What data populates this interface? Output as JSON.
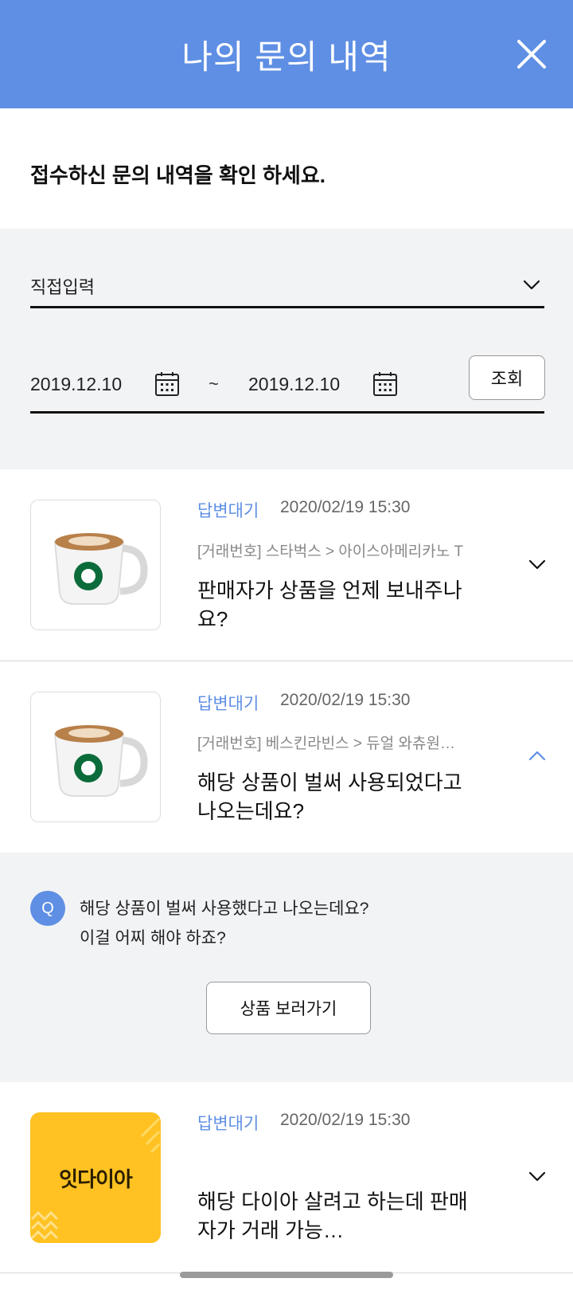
{
  "header": {
    "title": "나의 문의 내역"
  },
  "intro": "접수하신 문의 내역을 확인 하세요.",
  "filter": {
    "select_value": "직접입력",
    "start_date": "2019.12.10",
    "separator": "~",
    "end_date": "2019.12.10",
    "search_label": "조회"
  },
  "inquiries": [
    {
      "status": "답변대기",
      "date": "2020/02/19 15:30",
      "trade": "[거래번호] 스타벅스 > 아이스아메리카노 T",
      "question": "판매자가 상품을 언제 보내주나요?"
    },
    {
      "status": "답변대기",
      "date": "2020/02/19 15:30",
      "trade": "[거래번호] 베스킨라빈스 > 듀얼 와츄원…",
      "question": "해당 상품이 벌써 사용되었다고 나오는데요?",
      "expanded": true
    },
    {
      "status": "답변대기",
      "date": "2020/02/19 15:30",
      "trade": "",
      "question": "해당 다이아 살려고 하는데 판매자가 거래 가능…",
      "brand": "잇다이아"
    }
  ],
  "answer": {
    "badge": "Q",
    "line1": "해당 상품이 벌써 사용했다고 나오는데요?",
    "line2": "이걸 어찌 해야 하죠?",
    "button_label": "상품 보러가기"
  },
  "colors": {
    "header": "#5f8fe4",
    "accent": "#5f8fe4",
    "panel": "#f2f3f5",
    "brand_yellow": "#ffc222"
  }
}
